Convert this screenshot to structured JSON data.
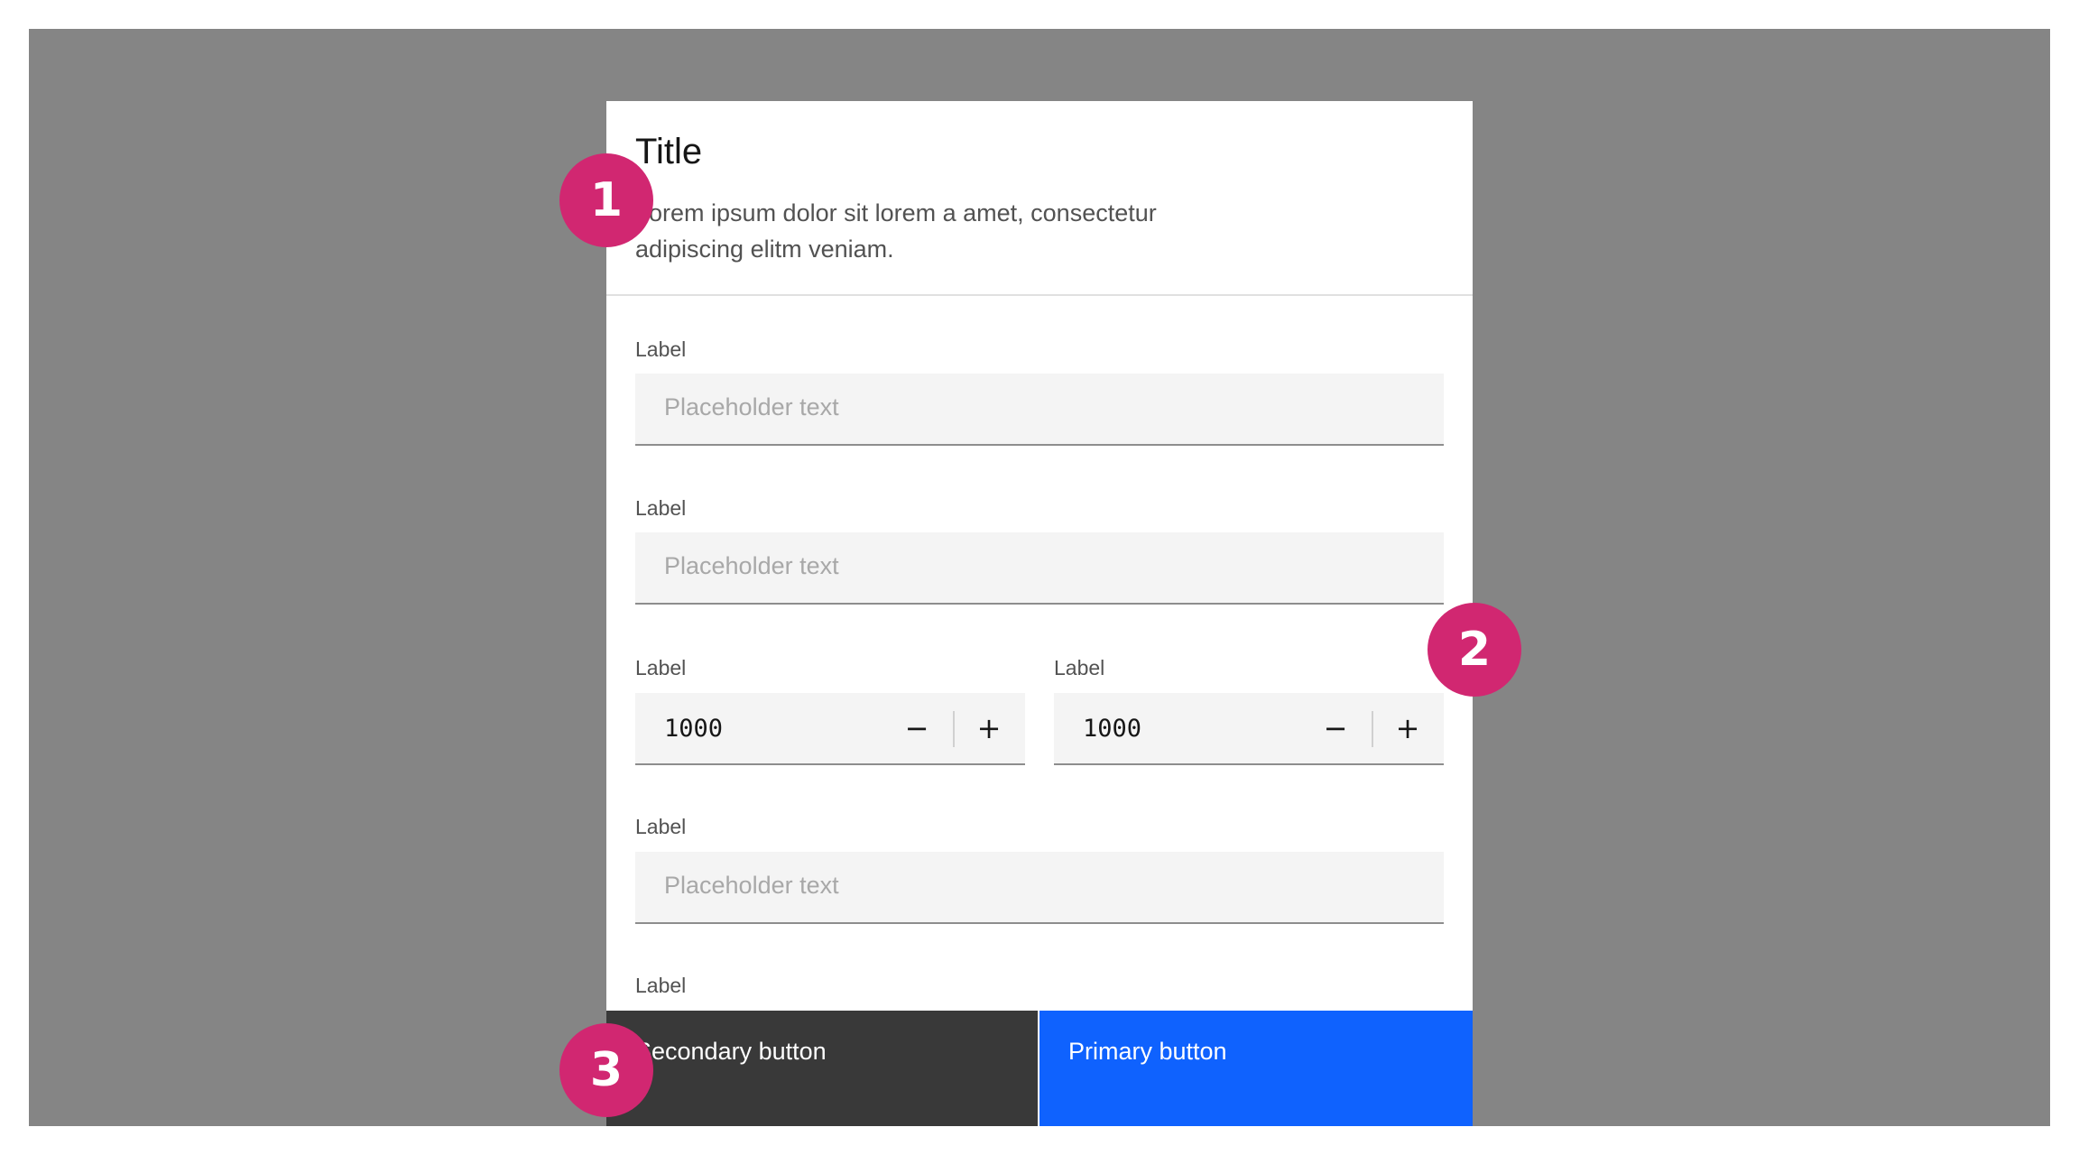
{
  "modal": {
    "title": "Title",
    "description": "Lorem ipsum dolor sit lorem a amet, consectetur adipiscing elitm veniam."
  },
  "form": {
    "field1": {
      "label": "Label",
      "placeholder": "Placeholder text"
    },
    "field2": {
      "label": "Label",
      "placeholder": "Placeholder text"
    },
    "number1": {
      "label": "Label",
      "value": "1000",
      "decrement": "−",
      "increment": "+"
    },
    "number2": {
      "label": "Label",
      "value": "1000",
      "decrement": "−",
      "increment": "+"
    },
    "field3": {
      "label": "Label",
      "placeholder": "Placeholder text"
    },
    "field4": {
      "label": "Label"
    }
  },
  "buttons": {
    "secondary": "Secondary button",
    "primary": "Primary button"
  },
  "markers": [
    "1",
    "2",
    "3"
  ],
  "colors": {
    "overlay": "#858585",
    "primary": "#0f62fe",
    "secondary": "#393939",
    "marker": "#d12771"
  }
}
